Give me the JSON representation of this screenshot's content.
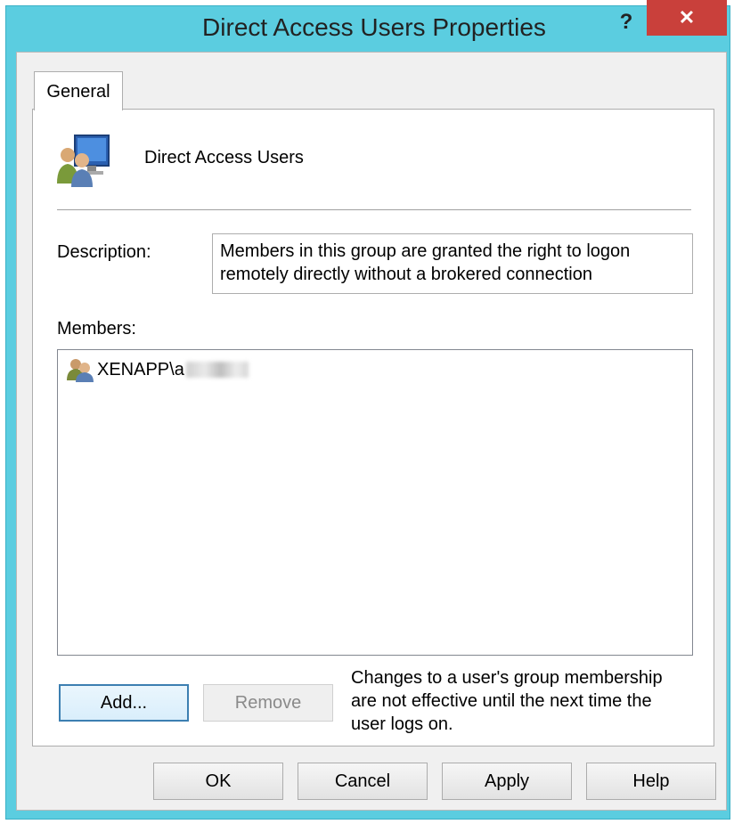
{
  "window": {
    "title": "Direct Access Users Properties",
    "help_label": "?",
    "close_label": "✕",
    "accent_color": "#5bcde0",
    "close_color": "#c9403b"
  },
  "tabs": [
    {
      "label": "General",
      "selected": true
    }
  ],
  "group": {
    "icon": "group-icon",
    "name": "Direct Access Users"
  },
  "description": {
    "label": "Description:",
    "value": "Members in this group are granted the right to logon remotely directly without a brokered connection"
  },
  "members": {
    "label": "Members:",
    "items": [
      {
        "icon": "user-group-icon",
        "name": "XENAPP\\a"
      }
    ]
  },
  "actions": {
    "add_label": "Add...",
    "remove_label": "Remove",
    "note": "Changes to a user's group membership are not effective until the next time the user logs on."
  },
  "footer": {
    "ok_label": "OK",
    "cancel_label": "Cancel",
    "apply_label": "Apply",
    "help_label": "Help"
  }
}
